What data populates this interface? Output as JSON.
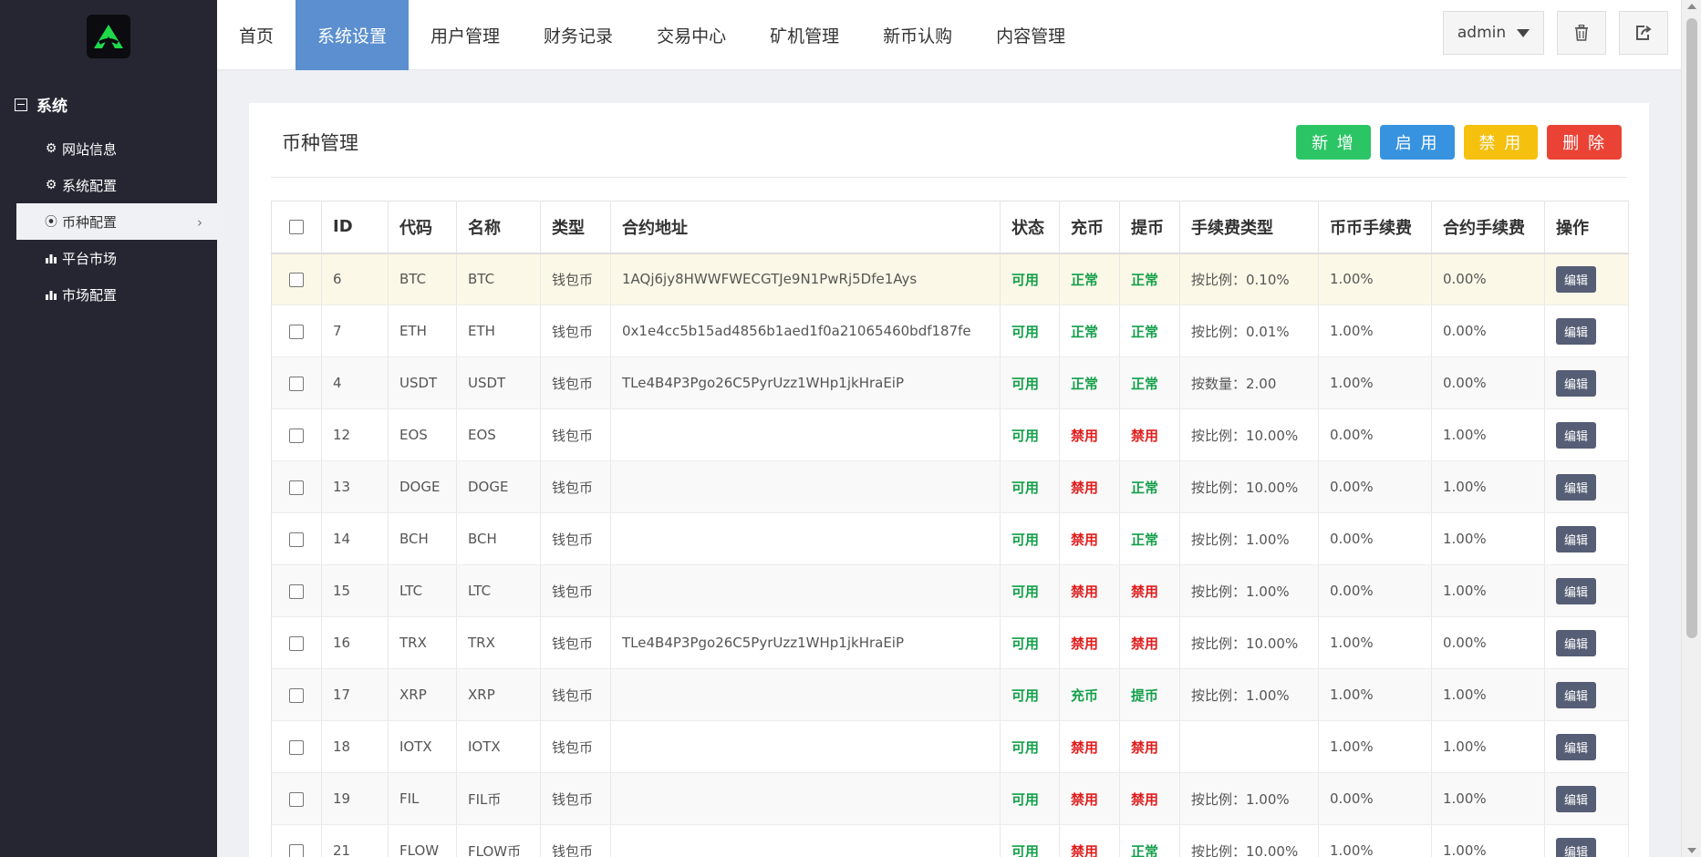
{
  "sidebar": {
    "section_title": "系统",
    "items": [
      {
        "label": "网站信息",
        "icon": "gear-icon",
        "active": false
      },
      {
        "label": "系统配置",
        "icon": "gear-icon",
        "active": false
      },
      {
        "label": "币种配置",
        "icon": "target-icon",
        "active": true
      },
      {
        "label": "平台市场",
        "icon": "bar-chart-icon",
        "active": false
      },
      {
        "label": "市场配置",
        "icon": "bar-chart-icon",
        "active": false
      }
    ]
  },
  "nav": {
    "tabs": [
      "首页",
      "系统设置",
      "用户管理",
      "财务记录",
      "交易中心",
      "矿机管理",
      "新币认购",
      "内容管理"
    ],
    "active_index": 1,
    "user": "admin"
  },
  "panel": {
    "title": "币种管理",
    "buttons": {
      "add": "新 增",
      "enable": "启 用",
      "disable": "禁 用",
      "delete": "删 除"
    }
  },
  "table": {
    "headers": [
      "ID",
      "代码",
      "名称",
      "类型",
      "合约地址",
      "状态",
      "充币",
      "提币",
      "手续费类型",
      "币币手续费",
      "合约手续费",
      "操作"
    ],
    "edit_label": "编辑",
    "rows": [
      [
        "6",
        "BTC",
        "BTC",
        "钱包币",
        "1AQj6jy8HWWFWECGTJe9N1PwRj5Dfe1Ays",
        "可用",
        "正常",
        "正常",
        "按比例：0.10%",
        "1.00%",
        "0.00%"
      ],
      [
        "7",
        "ETH",
        "ETH",
        "钱包币",
        "0x1e4cc5b15ad4856b1aed1f0a21065460bdf187fe",
        "可用",
        "正常",
        "正常",
        "按比例：0.01%",
        "1.00%",
        "0.00%"
      ],
      [
        "4",
        "USDT",
        "USDT",
        "钱包币",
        "TLe4B4P3Pgo26C5PyrUzz1WHp1jkHraEiP",
        "可用",
        "正常",
        "正常",
        "按数量：2.00",
        "1.00%",
        "0.00%"
      ],
      [
        "12",
        "EOS",
        "EOS",
        "钱包币",
        "",
        "可用",
        "禁用",
        "禁用",
        "按比例：10.00%",
        "0.00%",
        "1.00%"
      ],
      [
        "13",
        "DOGE",
        "DOGE",
        "钱包币",
        "",
        "可用",
        "禁用",
        "正常",
        "按比例：10.00%",
        "0.00%",
        "1.00%"
      ],
      [
        "14",
        "BCH",
        "BCH",
        "钱包币",
        "",
        "可用",
        "禁用",
        "正常",
        "按比例：1.00%",
        "0.00%",
        "1.00%"
      ],
      [
        "15",
        "LTC",
        "LTC",
        "钱包币",
        "",
        "可用",
        "禁用",
        "禁用",
        "按比例：1.00%",
        "0.00%",
        "1.00%"
      ],
      [
        "16",
        "TRX",
        "TRX",
        "钱包币",
        "TLe4B4P3Pgo26C5PyrUzz1WHp1jkHraEiP",
        "可用",
        "禁用",
        "禁用",
        "按比例：10.00%",
        "1.00%",
        "0.00%"
      ],
      [
        "17",
        "XRP",
        "XRP",
        "钱包币",
        "",
        "可用",
        "充币",
        "提币",
        "按比例：1.00%",
        "1.00%",
        "1.00%"
      ],
      [
        "18",
        "IOTX",
        "IOTX",
        "钱包币",
        "",
        "可用",
        "禁用",
        "禁用",
        "",
        "1.00%",
        "1.00%"
      ],
      [
        "19",
        "FIL",
        "FIL币",
        "钱包币",
        "",
        "可用",
        "禁用",
        "禁用",
        "按比例：1.00%",
        "0.00%",
        "1.00%"
      ],
      [
        "21",
        "FLOW",
        "FLOW币",
        "钱包币",
        "",
        "可用",
        "禁用",
        "正常",
        "按比例：10.00%",
        "1.00%",
        "1.00%"
      ]
    ]
  },
  "colors": {
    "sidebar": "#262633",
    "nav_active": "#5b8fd0",
    "ok": "#14a04a",
    "no": "#e01d1d"
  }
}
